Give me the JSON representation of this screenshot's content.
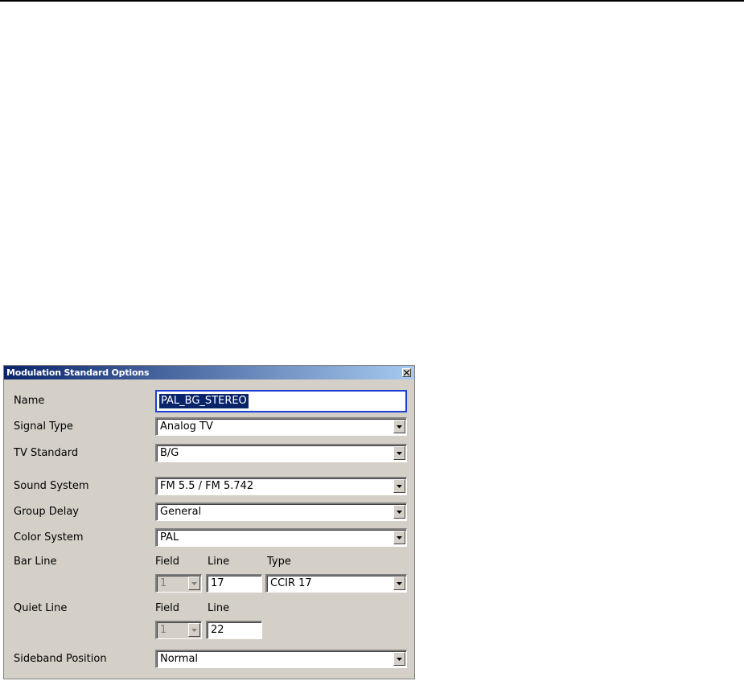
{
  "dialog": {
    "title": "Modulation Standard Options",
    "close_icon": "close-icon"
  },
  "fields": {
    "name": {
      "label": "Name",
      "value": "PAL_BG_STEREO"
    },
    "signal_type": {
      "label": "Signal Type",
      "value": "Analog TV"
    },
    "tv_standard": {
      "label": "TV Standard",
      "value": "B/G"
    },
    "sound_system": {
      "label": "Sound System",
      "value": "FM 5.5 / FM 5.742"
    },
    "group_delay": {
      "label": "Group Delay",
      "value": "General"
    },
    "color_system": {
      "label": "Color System",
      "value": "PAL"
    },
    "bar_line": {
      "label": "Bar Line",
      "field_header": "Field",
      "line_header": "Line",
      "type_header": "Type",
      "field_value": "1",
      "line_value": "17",
      "type_value": "CCIR 17"
    },
    "quiet_line": {
      "label": "Quiet Line",
      "field_header": "Field",
      "line_header": "Line",
      "field_value": "1",
      "line_value": "22"
    },
    "sideband_position": {
      "label": "Sideband Position",
      "value": "Normal"
    }
  },
  "icons": {
    "dropdown": "chevron-down-icon"
  }
}
